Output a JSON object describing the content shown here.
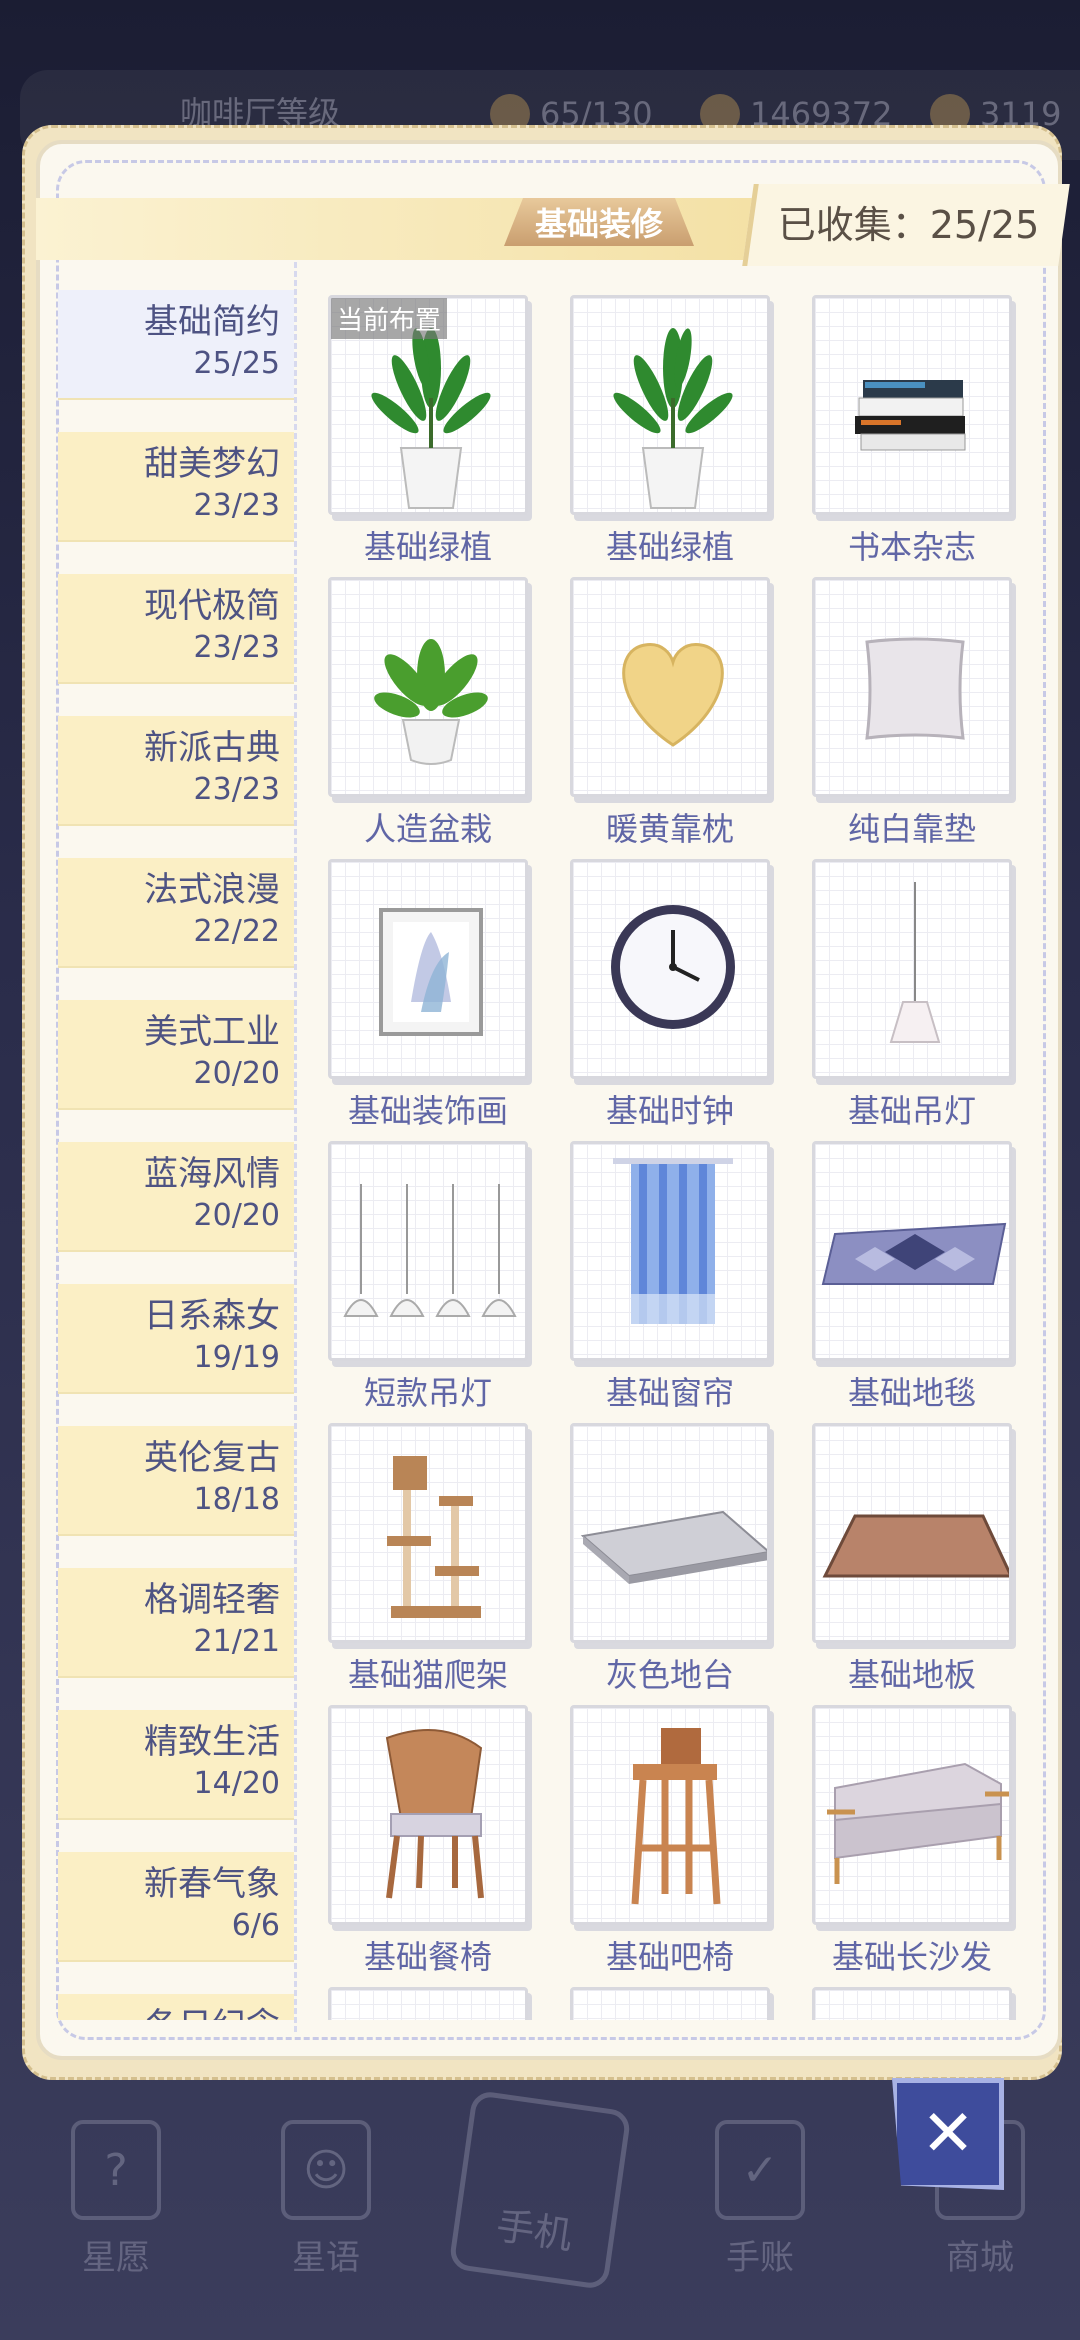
{
  "background": {
    "level_label": "咖啡厅等级",
    "stat1": "65/130",
    "stat2": "1469372",
    "stat3": "3119",
    "nav": [
      "星愿",
      "星语",
      "手机",
      "手账",
      "商城"
    ]
  },
  "header": {
    "tab_label": "基础装修",
    "collected": "已收集：25/25"
  },
  "categories": [
    {
      "name": "基础简约",
      "count": "25/25"
    },
    {
      "name": "甜美梦幻",
      "count": "23/23"
    },
    {
      "name": "现代极简",
      "count": "23/23"
    },
    {
      "name": "新派古典",
      "count": "23/23"
    },
    {
      "name": "法式浪漫",
      "count": "22/22"
    },
    {
      "name": "美式工业",
      "count": "20/20"
    },
    {
      "name": "蓝海风情",
      "count": "20/20"
    },
    {
      "name": "日系森女",
      "count": "19/19"
    },
    {
      "name": "英伦复古",
      "count": "18/18"
    },
    {
      "name": "格调轻奢",
      "count": "21/21"
    },
    {
      "name": "精致生活",
      "count": "14/20"
    },
    {
      "name": "新春气象",
      "count": "6/6"
    },
    {
      "name": "冬日纪念",
      "count": ""
    }
  ],
  "items": [
    {
      "label": "基础绿植",
      "icon": "plant-icon",
      "current": "当前布置"
    },
    {
      "label": "基础绿植",
      "icon": "plant-icon"
    },
    {
      "label": "书本杂志",
      "icon": "books-icon"
    },
    {
      "label": "人造盆栽",
      "icon": "potted-plant-icon"
    },
    {
      "label": "暖黄靠枕",
      "icon": "heart-pillow-icon"
    },
    {
      "label": "纯白靠垫",
      "icon": "cushion-icon"
    },
    {
      "label": "基础装饰画",
      "icon": "painting-icon"
    },
    {
      "label": "基础时钟",
      "icon": "clock-icon"
    },
    {
      "label": "基础吊灯",
      "icon": "pendant-lamp-icon"
    },
    {
      "label": "短款吊灯",
      "icon": "short-lamps-icon"
    },
    {
      "label": "基础窗帘",
      "icon": "curtain-icon"
    },
    {
      "label": "基础地毯",
      "icon": "rug-icon"
    },
    {
      "label": "基础猫爬架",
      "icon": "cat-tree-icon"
    },
    {
      "label": "灰色地台",
      "icon": "gray-platform-icon"
    },
    {
      "label": "基础地板",
      "icon": "floor-icon"
    },
    {
      "label": "基础餐椅",
      "icon": "dining-chair-icon"
    },
    {
      "label": "基础吧椅",
      "icon": "bar-stool-icon"
    },
    {
      "label": "基础长沙发",
      "icon": "sofa-icon"
    }
  ],
  "close_label": "✕",
  "colors": {
    "accent_blue": "#3e4c9c",
    "label_text": "#6066a6",
    "category_bg": "#fbefc5"
  }
}
